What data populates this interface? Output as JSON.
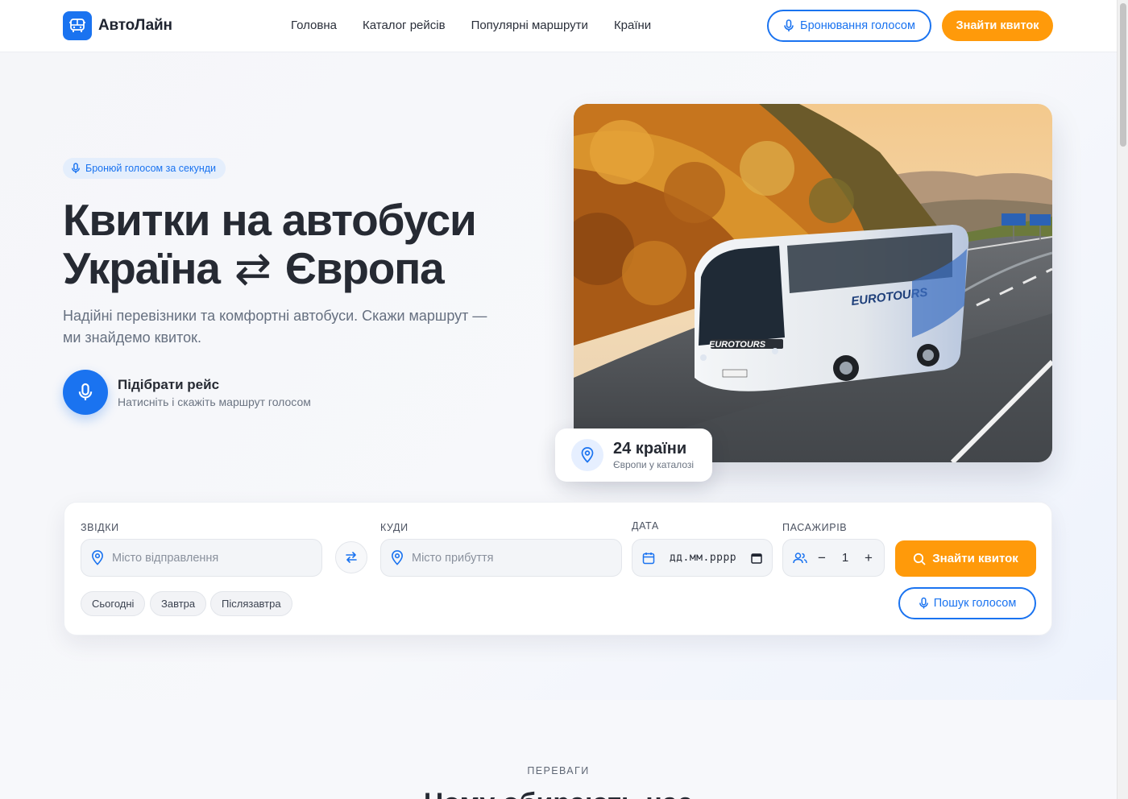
{
  "header": {
    "logo_text": "АвтоЛайн",
    "nav": [
      "Головна",
      "Каталог рейсів",
      "Популярні маршрути",
      "Країни"
    ],
    "voice_button": "Бронювання голосом",
    "find_button": "Знайти квиток"
  },
  "hero": {
    "badge": "Бронюй голосом за секунди",
    "title_line1": "Квитки на автобуси",
    "title_line2_left": "Україна",
    "title_arrows": "⇄",
    "title_line2_right": "Європа",
    "subtitle": "Надійні перевізники та комфортні автобуси. Скажи маршрут — ми знайдемо квиток.",
    "mic_title": "Підібрати рейс",
    "mic_subtitle": "Натисніть і скажіть маршрут голосом",
    "stat_big": "24 країни",
    "stat_small": "Європи у каталозі"
  },
  "search": {
    "from_label": "ЗВІДКИ",
    "from_placeholder": "Місто відправлення",
    "to_label": "КУДИ",
    "to_placeholder": "Місто прибуття",
    "date_label": "ДАТА",
    "date_placeholder": "дд.мм.рррр",
    "passengers_label": "ПАСАЖИРІВ",
    "passengers_value": "1",
    "minus": "−",
    "plus": "+",
    "search_button": "Знайти квиток",
    "voice_button": "Пошук голосом",
    "chips": [
      "Сьогодні",
      "Завтра",
      "Післязавтра"
    ]
  },
  "advantages": {
    "label": "ПЕРЕВАГИ",
    "title": "Чому обирають нас"
  },
  "colors": {
    "primary": "#1a73f0",
    "accent": "#ff9a0a"
  }
}
